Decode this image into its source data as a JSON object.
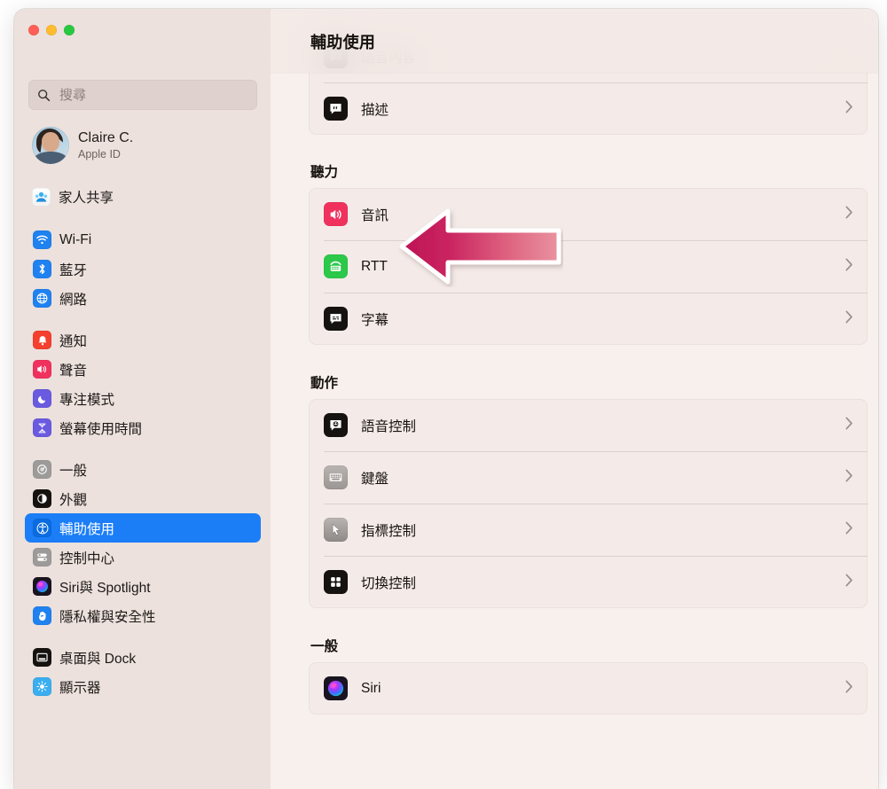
{
  "window": {
    "traffic_lights": [
      {
        "name": "close",
        "color": "#ff5f57"
      },
      {
        "name": "minimize",
        "color": "#febc2e"
      },
      {
        "name": "zoom",
        "color": "#28c840"
      }
    ]
  },
  "sidebar": {
    "search": {
      "value": "",
      "placeholder": "搜尋",
      "icon": "search-icon"
    },
    "account": {
      "name": "Claire C.",
      "subtitle": "Apple ID",
      "avatar": "user-avatar"
    },
    "family": {
      "label": "家人共享",
      "icon": "family-sharing-icon"
    },
    "groups": [
      {
        "items": [
          {
            "label": "Wi-Fi",
            "icon": "wifi-icon",
            "selected": false
          },
          {
            "label": "藍牙",
            "icon": "bluetooth-icon",
            "selected": false
          },
          {
            "label": "網路",
            "icon": "network-icon",
            "selected": false
          }
        ]
      },
      {
        "items": [
          {
            "label": "通知",
            "icon": "notifications-icon",
            "selected": false
          },
          {
            "label": "聲音",
            "icon": "sound-icon",
            "selected": false
          },
          {
            "label": "專注模式",
            "icon": "focus-icon",
            "selected": false
          },
          {
            "label": "螢幕使用時間",
            "icon": "screen-time-icon",
            "selected": false
          }
        ]
      },
      {
        "items": [
          {
            "label": "一般",
            "icon": "general-gear-icon",
            "selected": false
          },
          {
            "label": "外觀",
            "icon": "appearance-icon",
            "selected": false
          },
          {
            "label": "輔助使用",
            "icon": "accessibility-icon",
            "selected": true
          },
          {
            "label": "控制中心",
            "icon": "control-center-icon",
            "selected": false
          },
          {
            "label": "Siri與 Spotlight",
            "icon": "siri-icon",
            "selected": false
          },
          {
            "label": "隱私權與安全性",
            "icon": "privacy-hand-icon",
            "selected": false
          }
        ]
      },
      {
        "items": [
          {
            "label": "桌面與 Dock",
            "icon": "desktop-dock-icon",
            "selected": false
          },
          {
            "label": "顯示器",
            "icon": "displays-icon",
            "selected": false
          }
        ]
      }
    ]
  },
  "main": {
    "header_title": "輔助使用",
    "clipped_top_section": {
      "rows": [
        {
          "label": "語音內容",
          "icon": "spoken-content-icon",
          "chevron": "›"
        },
        {
          "label": "描述",
          "icon": "descriptions-icon",
          "chevron": "›"
        }
      ]
    },
    "sections": [
      {
        "title": "聽力",
        "rows": [
          {
            "label": "音訊",
            "icon": "audio-icon",
            "chevron": "›"
          },
          {
            "label": "RTT",
            "icon": "rtt-icon",
            "chevron": "›"
          },
          {
            "label": "字幕",
            "icon": "captions-icon",
            "chevron": "›"
          }
        ]
      },
      {
        "title": "動作",
        "rows": [
          {
            "label": "語音控制",
            "icon": "voice-control-icon",
            "chevron": "›"
          },
          {
            "label": "鍵盤",
            "icon": "keyboard-icon",
            "chevron": "›"
          },
          {
            "label": "指標控制",
            "icon": "pointer-control-icon",
            "chevron": "›"
          },
          {
            "label": "切換控制",
            "icon": "switch-control-icon",
            "chevron": "›"
          }
        ]
      },
      {
        "title": "一般",
        "rows": [
          {
            "label": "Siri",
            "icon": "siri-icon",
            "chevron": "›"
          }
        ]
      }
    ]
  },
  "annotation": {
    "arrow": {
      "name": "pink-pointer-arrow",
      "direction": "left",
      "points_at": "音訊",
      "gradient_from": "#c01a52",
      "gradient_to": "#e88ca0",
      "outline": "#ffffff"
    }
  },
  "colors": {
    "sidebar_bg": "#ece1dd",
    "content_bg": "#f8f0ed",
    "card_bg": "#f4ebe8",
    "selection_blue": "#1b7ef7",
    "text_primary": "#17130f",
    "text_secondary": "#6e625e"
  }
}
